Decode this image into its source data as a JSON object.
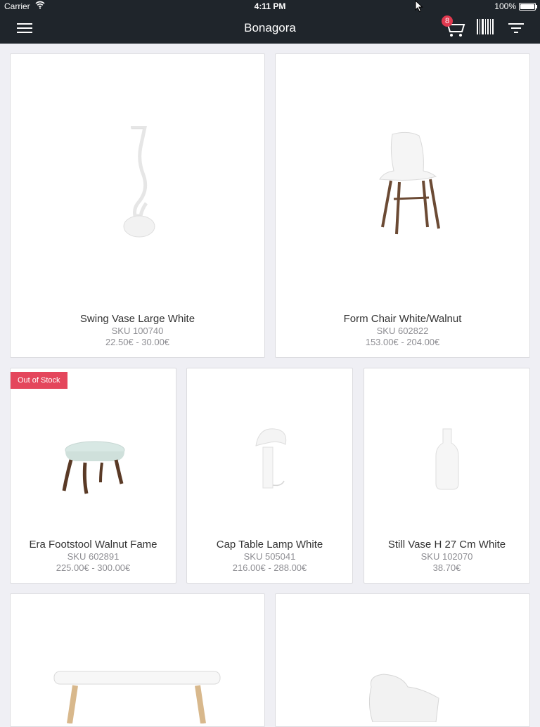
{
  "status_bar": {
    "carrier": "Carrier",
    "time": "4:11 PM",
    "battery": "100%"
  },
  "nav": {
    "title": "Bonagora",
    "cart_count": "8"
  },
  "colors": {
    "navbar": "#1f252b",
    "badge": "#e0394f",
    "out_of_stock": "#e4465c",
    "background": "#efeff4"
  },
  "products": [
    {
      "name": "Swing Vase Large White",
      "sku": "SKU 100740",
      "price": "22.50€ - 30.00€"
    },
    {
      "name": "Form Chair White/Walnut",
      "sku": "SKU 602822",
      "price": "153.00€ - 204.00€"
    },
    {
      "name": "Era Footstool Walnut Fame",
      "sku": "SKU 602891",
      "price": "225.00€ - 300.00€",
      "badge": "Out of Stock"
    },
    {
      "name": "Cap Table Lamp White",
      "sku": "SKU 505041",
      "price": "216.00€ - 288.00€"
    },
    {
      "name": "Still Vase H 27 Cm White",
      "sku": "SKU 102070",
      "price": "38.70€"
    },
    {
      "name": "",
      "sku": "",
      "price": ""
    },
    {
      "name": "",
      "sku": "",
      "price": ""
    }
  ]
}
